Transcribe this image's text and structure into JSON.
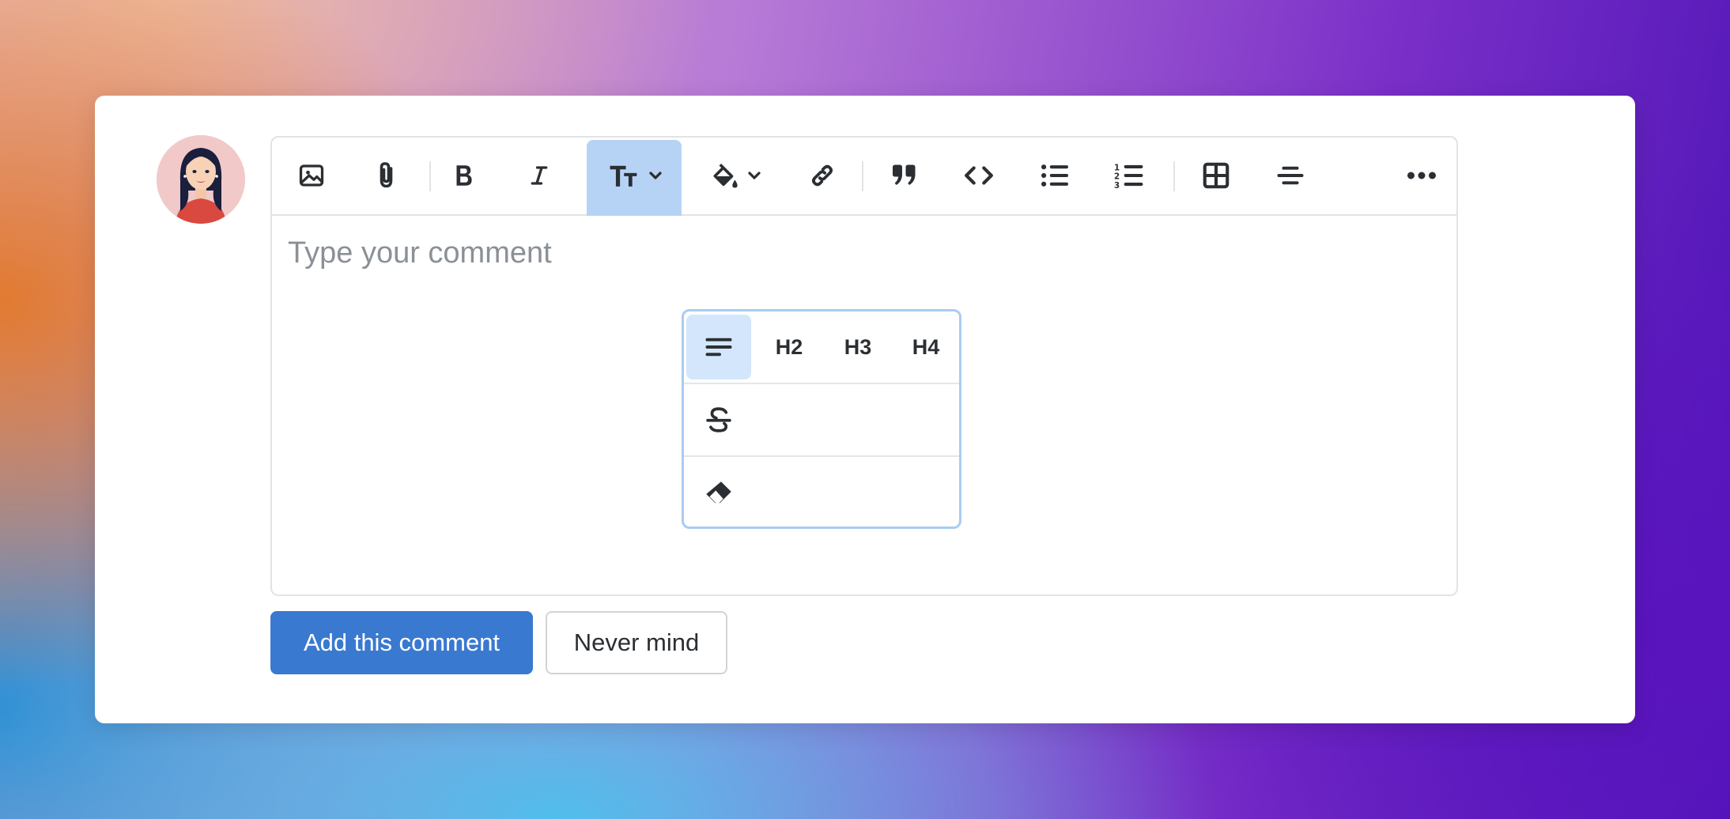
{
  "editor": {
    "placeholder": "Type your comment"
  },
  "toolbar": {
    "buttons": [
      {
        "icon": "image-icon"
      },
      {
        "icon": "paperclip-icon"
      },
      {
        "icon": "bold-icon"
      },
      {
        "icon": "italic-icon"
      },
      {
        "icon": "text-size-icon",
        "state": "active"
      },
      {
        "icon": "paint-bucket-icon"
      },
      {
        "icon": "link-icon"
      },
      {
        "icon": "quote-icon"
      },
      {
        "icon": "code-icon"
      },
      {
        "icon": "bulleted-list-icon"
      },
      {
        "icon": "numbered-list-icon"
      },
      {
        "icon": "table-icon"
      },
      {
        "icon": "horizontal-rule-icon"
      },
      {
        "icon": "more-icon"
      }
    ],
    "active_color": "#b6d3f5"
  },
  "text_style_menu": {
    "heading_options": [
      "H2",
      "H3",
      "H4"
    ],
    "selected": "paragraph",
    "other_options": [
      {
        "icon": "strikethrough-icon"
      },
      {
        "icon": "eraser-icon"
      }
    ]
  },
  "actions": {
    "submit_label": "Add this comment",
    "cancel_label": "Never mind"
  },
  "colors": {
    "primary": "#3a79d0",
    "menu_border": "#a9ccf2",
    "menu_selected": "#d3e6fb",
    "avatar_background": "#f1c9c9"
  }
}
